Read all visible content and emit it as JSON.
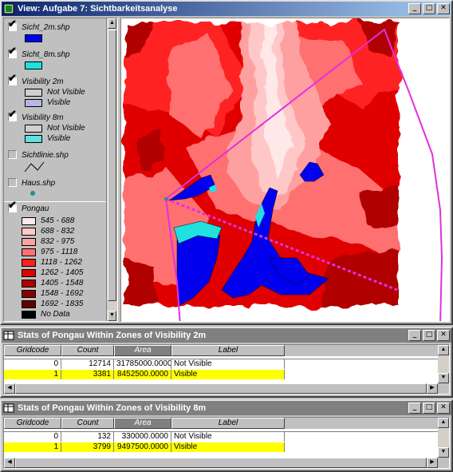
{
  "view_window": {
    "title": "View: Aufgabe 7: Sichtbarkeitsanalyse",
    "legend": [
      {
        "name": "Sicht_2m.shp",
        "checked": true,
        "symbols": [
          {
            "color": "#0000ee",
            "label": ""
          }
        ]
      },
      {
        "name": "Sicht_8m.shp",
        "checked": true,
        "symbols": [
          {
            "color": "#20e0e0",
            "label": ""
          }
        ]
      },
      {
        "name": "Visibility 2m",
        "checked": true,
        "symbols": [
          {
            "color": "#c0c0c0",
            "label": "Not Visible"
          },
          {
            "color": "#b8b8e8",
            "label": "Visible"
          }
        ]
      },
      {
        "name": "Visibility 8m",
        "checked": true,
        "symbols": [
          {
            "color": "#c0c0c0",
            "label": "Not Visible"
          },
          {
            "color": "#60e0e0",
            "label": "Visible"
          }
        ]
      },
      {
        "name": "Sichtlinie.shp",
        "checked": false,
        "symbols": []
      },
      {
        "name": "Haus.shp",
        "checked": false,
        "symbols": []
      }
    ],
    "pongau": {
      "name": "Pongau",
      "checked": true,
      "classes": [
        {
          "label": "545 - 688",
          "color": "#ffe8e8"
        },
        {
          "label": "688 - 832",
          "color": "#ffc8c8"
        },
        {
          "label": "832 - 975",
          "color": "#ffa0a0"
        },
        {
          "label": "975 - 1118",
          "color": "#ff7070"
        },
        {
          "label": "1118 - 1262",
          "color": "#ff2020"
        },
        {
          "label": "1262 - 1405",
          "color": "#e00000"
        },
        {
          "label": "1405 - 1548",
          "color": "#b00000"
        },
        {
          "label": "1548 - 1692",
          "color": "#880000"
        },
        {
          "label": "1692 - 1835",
          "color": "#600000"
        },
        {
          "label": "No Data",
          "color": "#000000"
        }
      ]
    }
  },
  "table_2m": {
    "title": "Stats of Pongau Within Zones of Visibility 2m",
    "columns": [
      "Gridcode",
      "Count",
      "Area",
      "Label"
    ],
    "rows": [
      {
        "gridcode": "0",
        "count": "12714",
        "area": "31785000.0000",
        "label": "Not Visible",
        "selected": false
      },
      {
        "gridcode": "1",
        "count": "3381",
        "area": "8452500.0000",
        "label": "Visible",
        "selected": true
      }
    ]
  },
  "table_8m": {
    "title": "Stats of Pongau Within Zones of Visibility 8m",
    "columns": [
      "Gridcode",
      "Count",
      "Area",
      "Label"
    ],
    "rows": [
      {
        "gridcode": "0",
        "count": "132",
        "area": "330000.0000",
        "label": "Not Visible",
        "selected": false
      },
      {
        "gridcode": "1",
        "count": "3799",
        "area": "9497500.0000",
        "label": "Visible",
        "selected": true
      }
    ]
  }
}
